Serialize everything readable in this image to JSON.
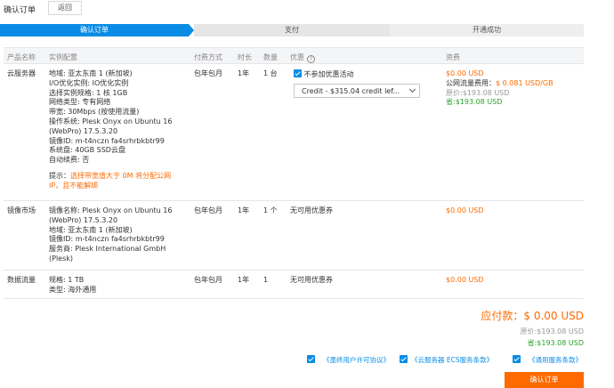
{
  "header": {
    "title": "确认订单",
    "back_label": "返回"
  },
  "steps": [
    "确认订单",
    "支付",
    "开通成功"
  ],
  "table": {
    "headers": [
      "产品名称",
      "实例配置",
      "付费方式",
      "时长",
      "数量",
      "优惠",
      "资费"
    ]
  },
  "rows": [
    {
      "name": "云服务器",
      "config": [
        "地域: 亚太东南 1 (新加坡)",
        "I/O优化实例: IO优化实例",
        "选择实例规格: 1 核 1GB",
        "网络类型: 专有网络",
        "带宽: 30Mbps (按使用流量)",
        "操作系统: Plesk Onyx on Ubuntu 16",
        "(WebPro) 17.5.3.20",
        "镜像ID: m-t4nczn fa4srhrbkbtr99",
        "系统盘: 40GB SSD云盘",
        "自动续费: 否"
      ],
      "tip_prefix": "提示：",
      "tip_warn_line1": "选择带宽值大于 0M 将分配公网",
      "tip_warn_line2": "IP，且不能解绑",
      "payment": "包年包月",
      "duration": "1年",
      "quantity": "1 台",
      "discount_check_label": "不参加优惠活动",
      "coupon_select": "Credit - $315.04 credit lef...",
      "price": "$0.00 USD",
      "traffic_fee_label": "公网流量费用：",
      "traffic_fee_value": "$ 0.081 USD/GB",
      "original": "原价:$193.08 USD",
      "saved": "省:$193.08 USD"
    },
    {
      "name": "镜像市场",
      "config": [
        "镜像名称: Plesk Onyx on Ubuntu 16",
        "(WebPro) 17.5.3.20",
        "地域: 亚太东南 1 (新加坡)",
        "镜像ID: m-t4nczn fa4srhrbkbtr99",
        "服务商: Plesk International GmbH",
        "(Plesk)"
      ],
      "payment": "包年包月",
      "duration": "1年",
      "quantity": "1 个",
      "discount": "无可用优惠券",
      "price": "$0.00 USD"
    },
    {
      "name": "数据流量",
      "config": [
        "规格: 1 TB",
        "类型: 海外通用"
      ],
      "payment": "包年包月",
      "duration": "1年",
      "quantity": "1",
      "discount": "无可用优惠券",
      "price": "$0.00 USD"
    }
  ],
  "summary": {
    "total_label": "应付款：",
    "total_value": "$ 0.00 USD",
    "original": "原价:$193.08 USD",
    "saved": "省:$193.08 USD"
  },
  "agreements": [
    "《墨终用户许可协议》",
    "《云服务器 ECS服务条款》",
    "《通用服务条款》"
  ],
  "confirm_button": "确认订单",
  "colors": {
    "accent": "#0a8ce5",
    "orange": "#ff6a00",
    "green": "#2aa12a"
  }
}
